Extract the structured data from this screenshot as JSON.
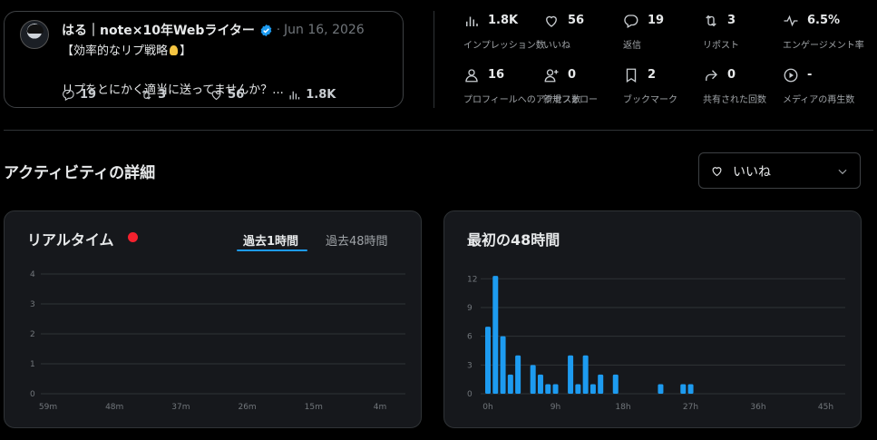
{
  "tweet": {
    "author": "はる｜note×10年Webライター",
    "date": "Jun 16, 2026",
    "line1_a": "【効率的なリプ戦略",
    "line1_b": "】",
    "line2": "リプをとにかく適当に送ってませんか？...",
    "replies": "19",
    "retweets": "3",
    "likes": "56",
    "views": "1.8K"
  },
  "metrics": [
    {
      "icon": "bar-chart-icon",
      "value": "1.8K",
      "label": "インプレッション数"
    },
    {
      "icon": "heart-icon",
      "value": "56",
      "label": "いいね"
    },
    {
      "icon": "reply-icon",
      "value": "19",
      "label": "返信"
    },
    {
      "icon": "retweet-icon",
      "value": "3",
      "label": "リポスト"
    },
    {
      "icon": "pulse-icon",
      "value": "6.5%",
      "label": "エンゲージメント率"
    },
    {
      "icon": "person-icon",
      "value": "16",
      "label": "プロフィールへのアクセス数"
    },
    {
      "icon": "follow-icon",
      "value": "0",
      "label": "新規フォロー"
    },
    {
      "icon": "bookmark-icon",
      "value": "2",
      "label": "ブックマーク"
    },
    {
      "icon": "share-icon",
      "value": "0",
      "label": "共有された回数"
    },
    {
      "icon": "play-icon",
      "value": "-",
      "label": "メディアの再生数"
    }
  ],
  "activity": {
    "title": "アクティビティの詳細",
    "selected_metric": "いいね"
  },
  "realtime": {
    "title": "リアルタイム",
    "tab_1h": "過去1時間",
    "tab_48h": "過去48時間"
  },
  "first48": {
    "title": "最初の48時間"
  },
  "colors": {
    "accent": "#1d9bf0",
    "live": "#f4212e",
    "bar": "#1d9bf0"
  },
  "chart_data": [
    {
      "type": "bar",
      "x_ticks": [
        "59m",
        "48m",
        "37m",
        "26m",
        "15m",
        "4m"
      ],
      "y_ticks": [
        0,
        1,
        2,
        3,
        4
      ],
      "ylim": [
        0,
        4
      ],
      "values": []
    },
    {
      "type": "bar",
      "x_ticks": [
        "0h",
        "9h",
        "18h",
        "27h",
        "36h",
        "45h"
      ],
      "y_ticks": [
        0,
        3,
        6,
        9,
        12
      ],
      "ylim": [
        0,
        12.5
      ],
      "x": [
        0,
        1,
        2,
        3,
        4,
        6,
        7,
        8,
        9,
        11,
        12,
        13,
        14,
        15,
        17,
        23,
        26,
        27
      ],
      "values": [
        7,
        12.3,
        6,
        2,
        4,
        3,
        2,
        1,
        1,
        4,
        1,
        4,
        1,
        2,
        2,
        1,
        1,
        1
      ]
    }
  ]
}
